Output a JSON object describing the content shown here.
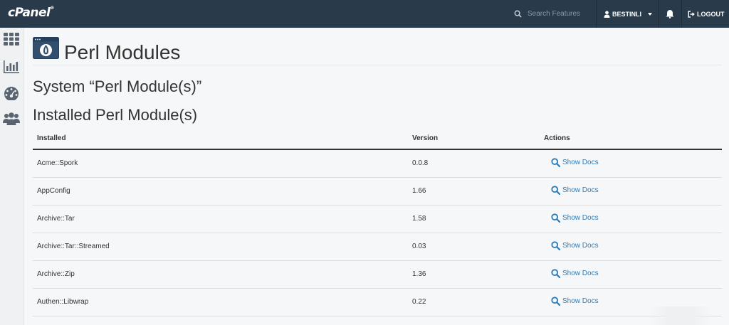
{
  "app": {
    "logo": "cPanel",
    "logo_mark": "®"
  },
  "topbar": {
    "search_placeholder": "Search Features",
    "user_name": "BESTINLI",
    "logout_label": "LOGOUT"
  },
  "sidebar": {
    "items": [
      {
        "icon": "grid-icon"
      },
      {
        "icon": "bar-chart-icon"
      },
      {
        "icon": "dashboard-gauge-icon"
      },
      {
        "icon": "users-icon"
      }
    ]
  },
  "page": {
    "title": "Perl Modules",
    "system_heading": "System “Perl Module(s)”",
    "installed_heading": "Installed Perl Module(s)"
  },
  "table": {
    "headers": {
      "installed": "Installed",
      "version": "Version",
      "actions": "Actions"
    },
    "action_label": "Show Docs",
    "rows": [
      {
        "name": "Acme::Spork",
        "version": "0.0.8"
      },
      {
        "name": "AppConfig",
        "version": "1.66"
      },
      {
        "name": "Archive::Tar",
        "version": "1.58"
      },
      {
        "name": "Archive::Tar::Streamed",
        "version": "0.03"
      },
      {
        "name": "Archive::Zip",
        "version": "1.36"
      },
      {
        "name": "Authen::Libwrap",
        "version": "0.22"
      }
    ]
  },
  "colors": {
    "topbar": "#293a4a",
    "link": "#2b7bb9",
    "sidebar_icon": "#5a6470"
  }
}
